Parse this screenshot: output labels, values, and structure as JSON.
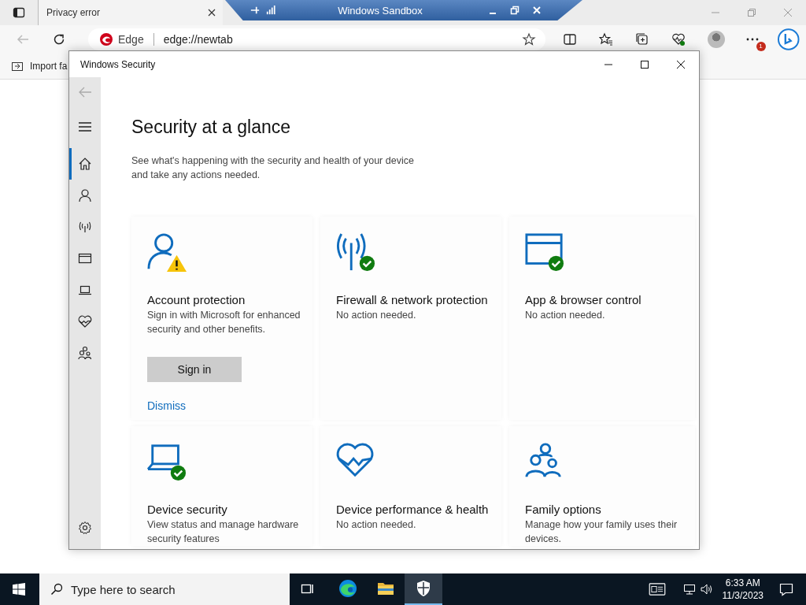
{
  "browser": {
    "tabs": [
      {
        "title": "Privacy error"
      }
    ],
    "address_bar": {
      "brand": "Edge",
      "url": "edge://newtab"
    },
    "menu_badge": "1",
    "favorites_bar": [
      {
        "label": "Import fa"
      }
    ]
  },
  "sandbox_bar": {
    "title": "Windows Sandbox"
  },
  "security_window": {
    "title": "Windows Security",
    "nav": [
      {
        "kind": "home",
        "selected": true
      },
      {
        "kind": "person",
        "selected": false
      },
      {
        "kind": "wireless",
        "selected": false
      },
      {
        "kind": "browser",
        "selected": false
      },
      {
        "kind": "laptop",
        "selected": false
      },
      {
        "kind": "heart",
        "selected": false
      },
      {
        "kind": "family",
        "selected": false
      }
    ],
    "heading": "Security at a glance",
    "subtitle": "See what's happening with the security and health of your device and take any actions needed.",
    "cards": [
      {
        "kind": "person",
        "badge": {
          "kind": "warning"
        },
        "title": "Account protection",
        "description": "Sign in with Microsoft for enhanced security and other benefits.",
        "button": "Sign in",
        "link": "Dismiss"
      },
      {
        "kind": "wireless",
        "badge": {
          "kind": "ok"
        },
        "title": "Firewall & network protection",
        "description": "No action needed."
      },
      {
        "kind": "browser",
        "badge": {
          "kind": "ok"
        },
        "title": "App & browser control",
        "description": "No action needed."
      },
      {
        "kind": "laptop",
        "badge": {
          "kind": "ok"
        },
        "title": "Device security",
        "description": "View status and manage hardware security features"
      },
      {
        "kind": "heart",
        "title": "Device performance & health",
        "description": "No action needed."
      },
      {
        "kind": "family",
        "title": "Family options",
        "description": "Manage how your family uses their devices."
      }
    ]
  },
  "taskbar": {
    "search": {
      "placeholder": "Type here to search"
    },
    "apps": [
      {
        "kind": "edge",
        "selected": false
      },
      {
        "kind": "folder",
        "selected": false
      },
      {
        "kind": "shield",
        "selected": true
      }
    ],
    "time": "6:33 AM",
    "date": "11/3/2023"
  }
}
